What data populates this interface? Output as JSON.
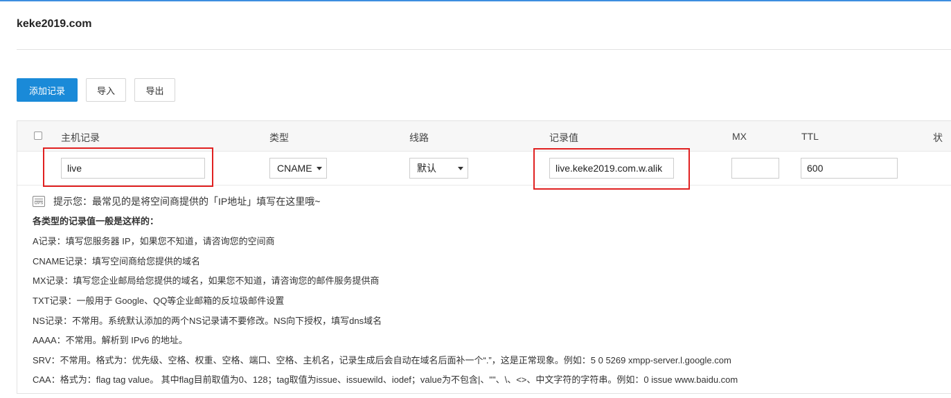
{
  "page": {
    "domain": "keke2019.com"
  },
  "toolbar": {
    "add_label": "添加记录",
    "import_label": "导入",
    "export_label": "导出"
  },
  "table": {
    "headers": {
      "host": "主机记录",
      "type": "类型",
      "line": "线路",
      "value": "记录值",
      "mx": "MX",
      "ttl": "TTL",
      "status": "状"
    }
  },
  "form": {
    "host": "live",
    "type": "CNAME",
    "line": "默认",
    "value": "live.keke2019.com.w.alik",
    "mx": "",
    "ttl": "600"
  },
  "tips": {
    "headline": "提示您：最常见的是将空间商提供的「IP地址」填写在这里哦~",
    "subtitle": "各类型的记录值一般是这样的：",
    "lines": [
      "A记录：填写您服务器 IP，如果您不知道，请咨询您的空间商",
      "CNAME记录：填写空间商给您提供的域名",
      "MX记录：填写您企业邮局给您提供的域名，如果您不知道，请咨询您的邮件服务提供商",
      "TXT记录：一般用于 Google、QQ等企业邮箱的反垃圾邮件设置",
      "NS记录：不常用。系统默认添加的两个NS记录请不要修改。NS向下授权，填写dns域名",
      "AAAA：不常用。解析到 IPv6 的地址。",
      "SRV：不常用。格式为：优先级、空格、权重、空格、端口、空格、主机名，记录生成后会自动在域名后面补一个“.”，这是正常现象。例如：5 0 5269 xmpp-server.l.google.com",
      "CAA：格式为：flag tag value。 其中flag目前取值为0、128；tag取值为issue、issuewild、iodef；value为不包含|、\"\"、\\、<>、中文字符的字符串。例如：0 issue www.baidu.com"
    ]
  },
  "colors": {
    "accent": "#1a8ad8",
    "highlight": "#e02020"
  }
}
